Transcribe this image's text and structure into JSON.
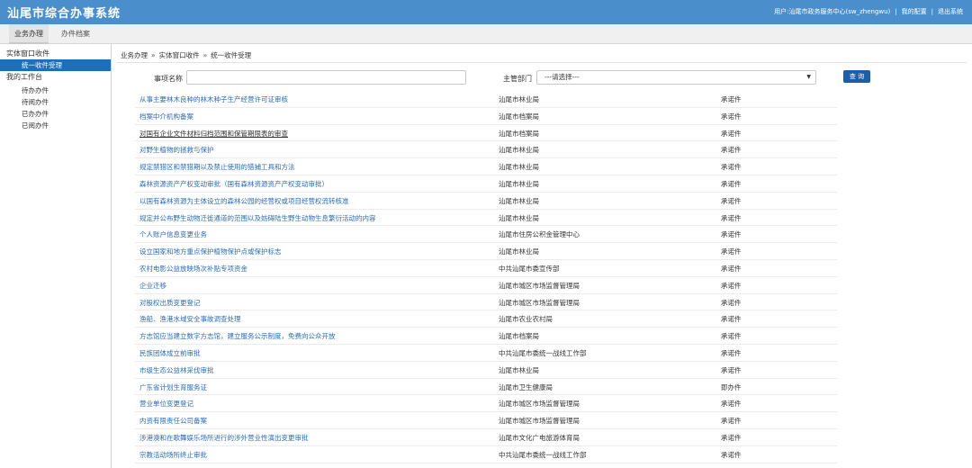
{
  "app": {
    "title": "汕尾市综合办事系统"
  },
  "user_bar": {
    "user": "用户:汕尾市政务服务中心(sw_zhengwu)",
    "config": "我的配置",
    "logout": "退出系统",
    "separator": "|"
  },
  "tabs": [
    {
      "label": "业务办理",
      "active": true
    },
    {
      "label": "办件档案",
      "active": false
    }
  ],
  "sidebar": {
    "group1": "实体窗口收件",
    "group1_items": [
      {
        "label": "统一收件受理",
        "active": true
      }
    ],
    "group2": "我的工作台",
    "group2_items": [
      {
        "label": "待办办件"
      },
      {
        "label": "待阅办件"
      },
      {
        "label": "已办办件"
      },
      {
        "label": "已阅办件"
      }
    ]
  },
  "breadcrumb": [
    "业务办理",
    "实体窗口收件",
    "统一收件受理"
  ],
  "breadcrumb_sep": "»",
  "search": {
    "item_label": "事项名称",
    "item_value": "",
    "dept_label": "主管部门",
    "dept_selected": "---请选择---",
    "query_button": "查 询"
  },
  "rows": [
    {
      "name": "从事主要林木良种的林木种子生产经营许可证审核",
      "dept": "汕尾市林业局",
      "type": "承诺件"
    },
    {
      "name": "档案中介机构备案",
      "dept": "汕尾市档案局",
      "type": "承诺件"
    },
    {
      "name": "对国有企业文件材料归档范围和保管期限表的审查",
      "dept": "汕尾市档案局",
      "type": "承诺件"
    },
    {
      "name": "对野生植物的拯救与保护",
      "dept": "汕尾市林业局",
      "type": "承诺件"
    },
    {
      "name": "规定禁猎区和禁猎期以及禁止使用的猎捕工具和方法",
      "dept": "汕尾市林业局",
      "type": "承诺件"
    },
    {
      "name": "森林资源资产产权变动审批（国有森林资源资产产权变动审批）",
      "dept": "汕尾市林业局",
      "type": "承诺件"
    },
    {
      "name": "以国有森林资源为主体设立的森林公园的经营权或项目经营权流转核准",
      "dept": "汕尾市林业局",
      "type": "承诺件"
    },
    {
      "name": "规定并公布野生动物迁徙通道的范围以及妨碍陆生野生动物生息繁衍活动的内容",
      "dept": "汕尾市林业局",
      "type": "承诺件"
    },
    {
      "name": "个人账户信息变更业务",
      "dept": "汕尾市住房公积金管理中心",
      "type": "承诺件"
    },
    {
      "name": "设立国家和地方重点保护植物保护点或保护标志",
      "dept": "汕尾市林业局",
      "type": "承诺件"
    },
    {
      "name": "农村电影公益放映场次补贴专项资金",
      "dept": "中共汕尾市委宣传部",
      "type": "承诺件"
    },
    {
      "name": "企业迁移",
      "dept": "汕尾市城区市场监督管理局",
      "type": "承诺件"
    },
    {
      "name": "对股权出质变更登记",
      "dept": "汕尾市城区市场监督管理局",
      "type": "承诺件"
    },
    {
      "name": "渔船、渔港水域安全事故调查处理",
      "dept": "汕尾市农业农村局",
      "type": "承诺件"
    },
    {
      "name": "方志馆应当建立数字方志馆，建立服务公示制度，免费向公众开放",
      "dept": "汕尾市档案局",
      "type": "承诺件"
    },
    {
      "name": "民族团体成立前审批",
      "dept": "中共汕尾市委统一战线工作部",
      "type": "承诺件"
    },
    {
      "name": "市级生态公益林采伐审批",
      "dept": "汕尾市林业局",
      "type": "承诺件"
    },
    {
      "name": "广东省计划生育服务证",
      "dept": "汕尾市卫生健康局",
      "type": "即办件"
    },
    {
      "name": "营业单位变更登记",
      "dept": "汕尾市城区市场监督管理局",
      "type": "承诺件"
    },
    {
      "name": "内资有限责任公司备案",
      "dept": "汕尾市城区市场监督管理局",
      "type": "承诺件"
    },
    {
      "name": "涉港澳和在歌舞娱乐场所进行的涉外营业性演出变更审批",
      "dept": "汕尾市文化广电旅游体育局",
      "type": "承诺件"
    },
    {
      "name": "宗教活动场所终止审批",
      "dept": "中共汕尾市委统一战线工作部",
      "type": "承诺件"
    }
  ]
}
